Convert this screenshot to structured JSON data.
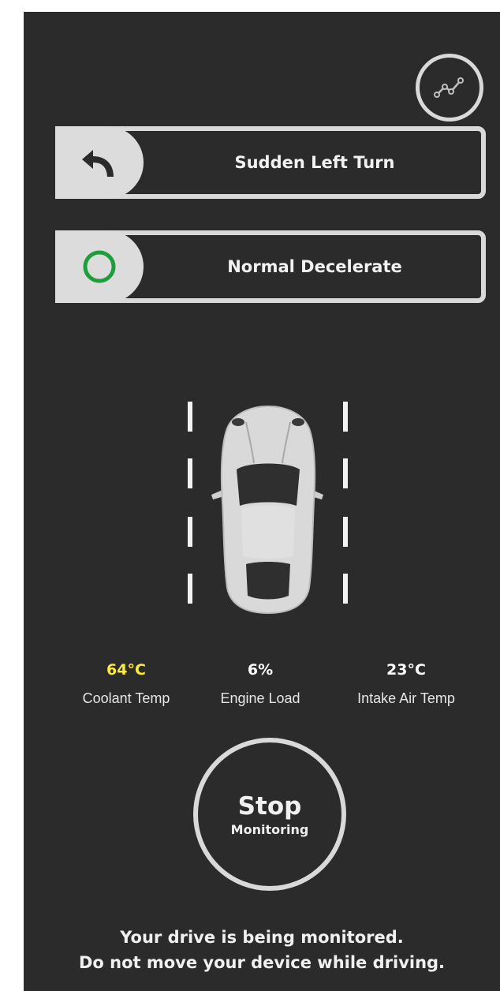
{
  "events": [
    {
      "label": "Sudden Left Turn",
      "icon": "left-turn-arrow-icon"
    },
    {
      "label": "Normal Decelerate",
      "icon": "green-ring-icon"
    }
  ],
  "stats": {
    "coolant": {
      "value": "64°C",
      "label": "Coolant Temp",
      "color": "#ffeb3b"
    },
    "engine_load": {
      "value": "6%",
      "label": "Engine Load"
    },
    "intake_air": {
      "value": "23°C",
      "label": "Intake Air Temp"
    }
  },
  "stop_button": {
    "main": "Stop",
    "sub": "Monitoring"
  },
  "footer": {
    "line1": "Your drive is being monitored.",
    "line2": "Do not move your device while driving."
  },
  "colors": {
    "background": "#2b2b2b",
    "outline": "#d9d9d9",
    "ok_green": "#1e9e3a",
    "highlight_yellow": "#ffeb3b"
  }
}
